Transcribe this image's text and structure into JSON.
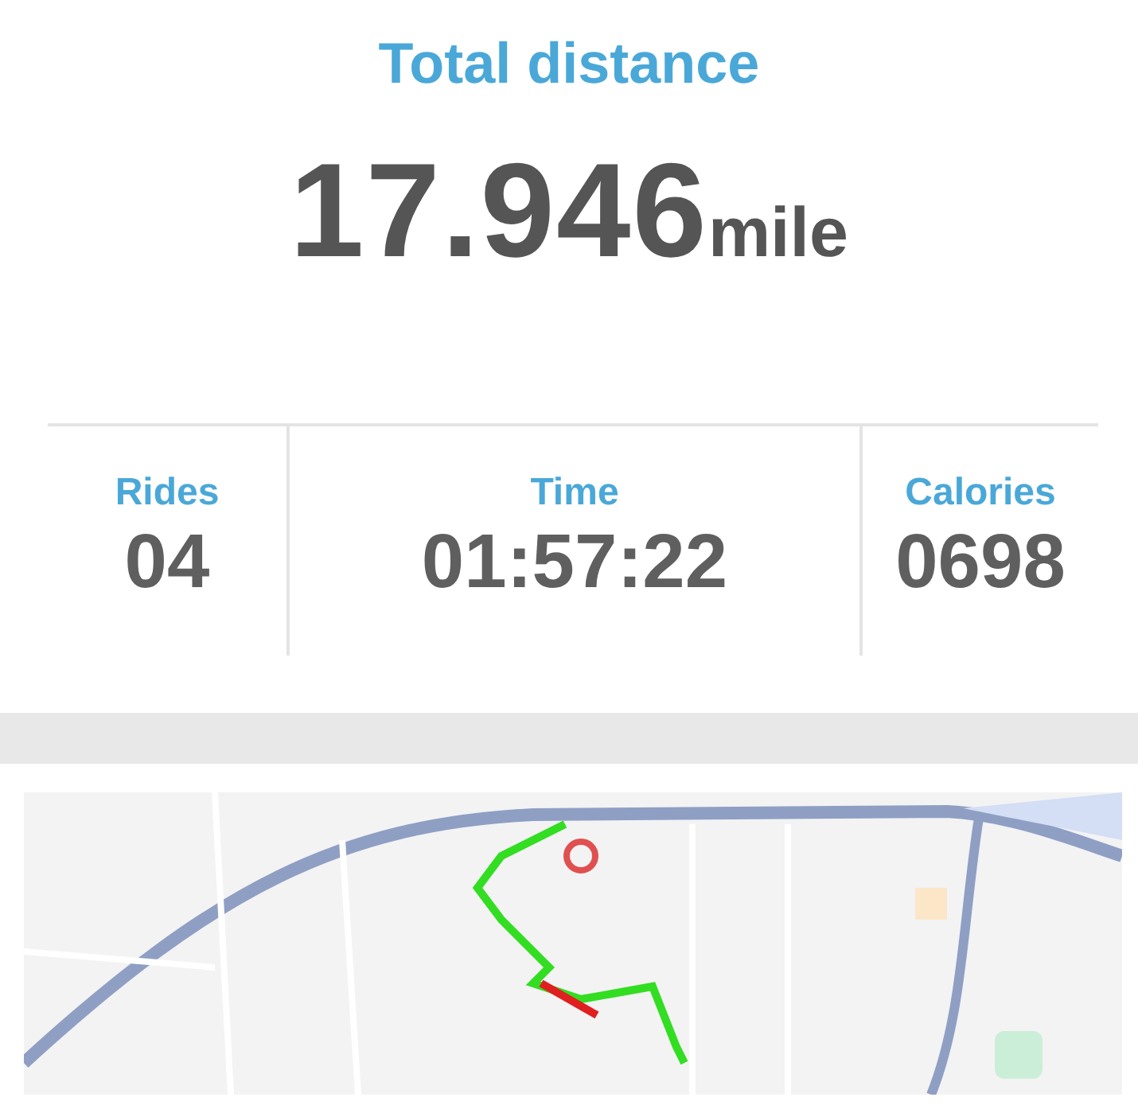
{
  "total": {
    "label": "Total distance",
    "value": "17.946",
    "unit": "mile"
  },
  "stats": [
    {
      "label": "Rides",
      "value": "04"
    },
    {
      "label": "Time",
      "value": "01:57:22"
    },
    {
      "label": "Calories",
      "value": "0698"
    }
  ]
}
